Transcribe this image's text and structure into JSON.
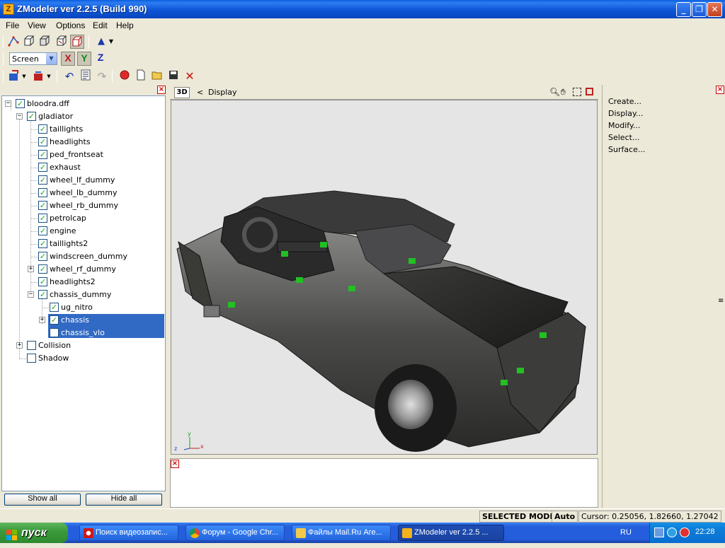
{
  "window": {
    "title": "ZModeler ver 2.2.5 (Build 990)",
    "icon": "zmodeler-logo-icon",
    "minimize": "_",
    "maximize": "❐",
    "close": "✕"
  },
  "menu": [
    "File",
    "View",
    "Options",
    "Edit",
    "Help"
  ],
  "toolbar": {
    "coord_mode": "Screen",
    "axis_x": "X",
    "axis_y": "Y",
    "axis_z": "Z"
  },
  "tree": {
    "root": "bloodra.dff",
    "items": [
      {
        "label": "gladiator"
      },
      {
        "label": "taillights"
      },
      {
        "label": "headlights"
      },
      {
        "label": "ped_frontseat"
      },
      {
        "label": "exhaust"
      },
      {
        "label": "wheel_lf_dummy"
      },
      {
        "label": "wheel_lb_dummy"
      },
      {
        "label": "wheel_rb_dummy"
      },
      {
        "label": "petrolcap"
      },
      {
        "label": "engine"
      },
      {
        "label": "taillights2"
      },
      {
        "label": "windscreen_dummy"
      },
      {
        "label": "wheel_rf_dummy"
      },
      {
        "label": "headlights2"
      },
      {
        "label": "chassis_dummy"
      },
      {
        "label": "ug_nitro"
      },
      {
        "label": "chassis"
      },
      {
        "label": "chassis_vlo"
      },
      {
        "label": "Collision"
      },
      {
        "label": "Shadow"
      }
    ],
    "show_all": "Show all",
    "hide_all": "Hide all"
  },
  "viewport": {
    "mode": "3D",
    "nav_arrow": "<",
    "title": "Display",
    "axis_x": "x",
    "axis_y": "y",
    "axis_z": "z"
  },
  "right_panel": {
    "items": [
      "Create...",
      "Display...",
      "Modify...",
      "Select...",
      "Surface..."
    ]
  },
  "status": {
    "mode": "SELECTED MODE",
    "auto": "Auto",
    "cursor": "Cursor: 0.25056, 1.82660, 1.27042"
  },
  "taskbar": {
    "start": "пуск",
    "tasks": [
      "Поиск видеозапис...",
      "Форум - Google Chr...",
      "Файлы Mail.Ru Аге...",
      "ZModeler ver 2.2.5 ..."
    ],
    "lang": "RU",
    "clock": "22:28"
  },
  "colors": {
    "titlebar": "#0A5FE0",
    "selection": "#316AC5",
    "viewport_bg": "#E5E5E5",
    "check_green": "#21A121"
  }
}
